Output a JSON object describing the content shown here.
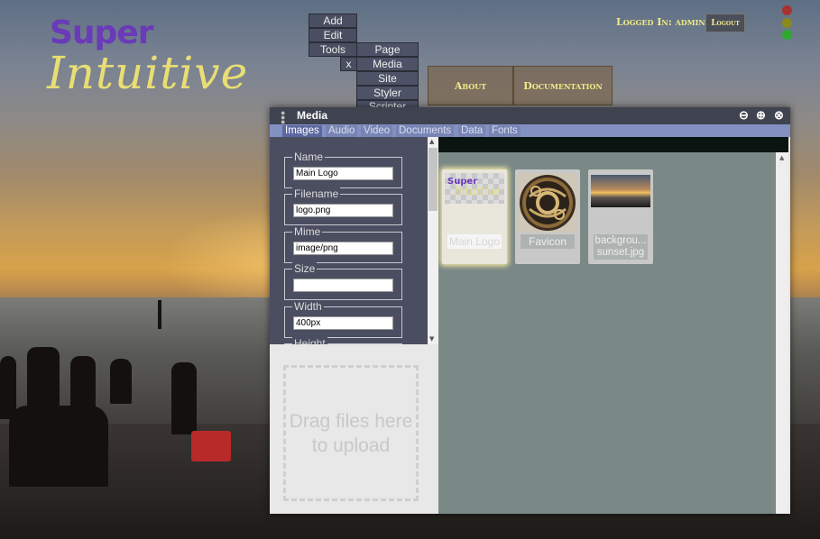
{
  "logo": {
    "super": "Super",
    "intuitive": "Intuitive"
  },
  "menu": {
    "items": [
      "Add",
      "Edit",
      "Tools"
    ],
    "close": "x",
    "tools_sub": [
      "Page",
      "Media",
      "Site",
      "Styler",
      "Scripter"
    ]
  },
  "nav": {
    "about": "About",
    "documentation": "Documentation"
  },
  "session": {
    "logged_in": "Logged In: admin",
    "logout": "Logout"
  },
  "lights": [
    "#a83232",
    "#8a8a1e",
    "#2fa82f"
  ],
  "window": {
    "title": "Media",
    "controls": {
      "minimize": "⊖",
      "maximize": "⊕",
      "close": "⊗"
    },
    "tabs": [
      "Images",
      "Audio",
      "Video",
      "Documents",
      "Data",
      "Fonts"
    ],
    "fields": [
      {
        "label": "Name",
        "value": "Main Logo"
      },
      {
        "label": "Filename",
        "value": "logo.png"
      },
      {
        "label": "Mime",
        "value": "image/png"
      },
      {
        "label": "Size",
        "value": ""
      },
      {
        "label": "Width",
        "value": "400px"
      },
      {
        "label": "Height",
        "value": ""
      }
    ],
    "dropzone": "Drag files here to upload",
    "thumbnails": [
      {
        "caption": "Main Logo",
        "logo_super": "Super",
        "logo_intuitive": "Intuitive"
      },
      {
        "caption": "Favicon"
      },
      {
        "caption": "backgrou... sunset.jpg"
      }
    ]
  }
}
